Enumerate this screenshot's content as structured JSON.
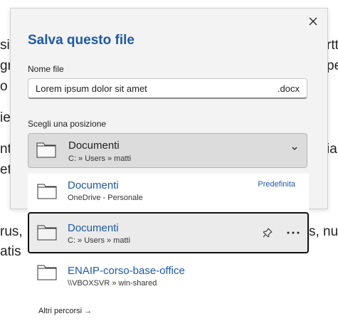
{
  "background_doc": {
    "lines": [
      "sit",
      "gna",
      "o l",
      "ie",
      "nt",
      "etr",
      "rus,",
      "atis"
    ],
    "right_lines": [
      "rtt",
      "pe",
      "",
      "",
      "ia",
      "",
      "s, nu",
      ""
    ]
  },
  "dialog": {
    "title": "Salva questo file",
    "close_icon": "close-icon",
    "name_label": "Nome file",
    "file_name": "Lorem ipsum dolor sit amet",
    "extension": ".docx",
    "location_label": "Scegli una posizione",
    "selected_location": {
      "title": "Documenti",
      "path": "C: » Users » matti"
    }
  },
  "locations": [
    {
      "title": "Documenti",
      "subtitle": "OneDrive - Personale",
      "badge": "Predefinita"
    },
    {
      "title": "Documenti",
      "subtitle": "C: » Users » matti",
      "selected": true
    },
    {
      "title": "ENAIP-corso-base-office",
      "subtitle": "\\\\VBOXSVR » win-shared"
    }
  ],
  "more_paths": "Altri percorsi →",
  "colors": {
    "accent": "#1d5aa8",
    "dialog_bg": "#f3f3f3",
    "selected_border": "#111111"
  }
}
